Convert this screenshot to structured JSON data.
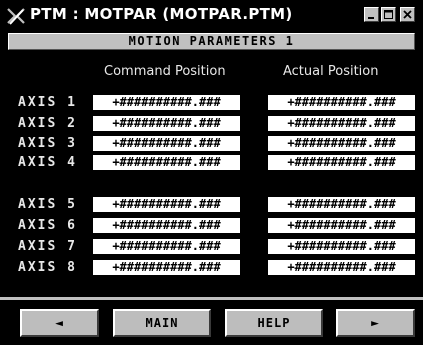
{
  "window": {
    "title": "PTM : MOTPAR (MOTPAR.PTM)",
    "subtitle": "MOTION PARAMETERS 1"
  },
  "headers": {
    "command": "Command Position",
    "actual": "Actual Position"
  },
  "axes": [
    {
      "label": "AXIS 1",
      "command": "+##########.###",
      "actual": "+##########.###"
    },
    {
      "label": "AXIS 2",
      "command": "+##########.###",
      "actual": "+##########.###"
    },
    {
      "label": "AXIS 3",
      "command": "+##########.###",
      "actual": "+##########.###"
    },
    {
      "label": "AXIS 4",
      "command": "+##########.###",
      "actual": "+##########.###"
    },
    {
      "label": "AXIS 5",
      "command": "+##########.###",
      "actual": "+##########.###"
    },
    {
      "label": "AXIS 6",
      "command": "+##########.###",
      "actual": "+##########.###"
    },
    {
      "label": "AXIS 7",
      "command": "+##########.###",
      "actual": "+##########.###"
    },
    {
      "label": "AXIS 8",
      "command": "+##########.###",
      "actual": "+##########.###"
    }
  ],
  "nav": {
    "prev_icon": "arrow-left-icon",
    "main_label": "MAIN",
    "help_label": "HELP",
    "next_icon": "arrow-right-icon"
  },
  "colors": {
    "background": "#000000",
    "panel": "#c0c0c0",
    "field": "#ffffff"
  }
}
